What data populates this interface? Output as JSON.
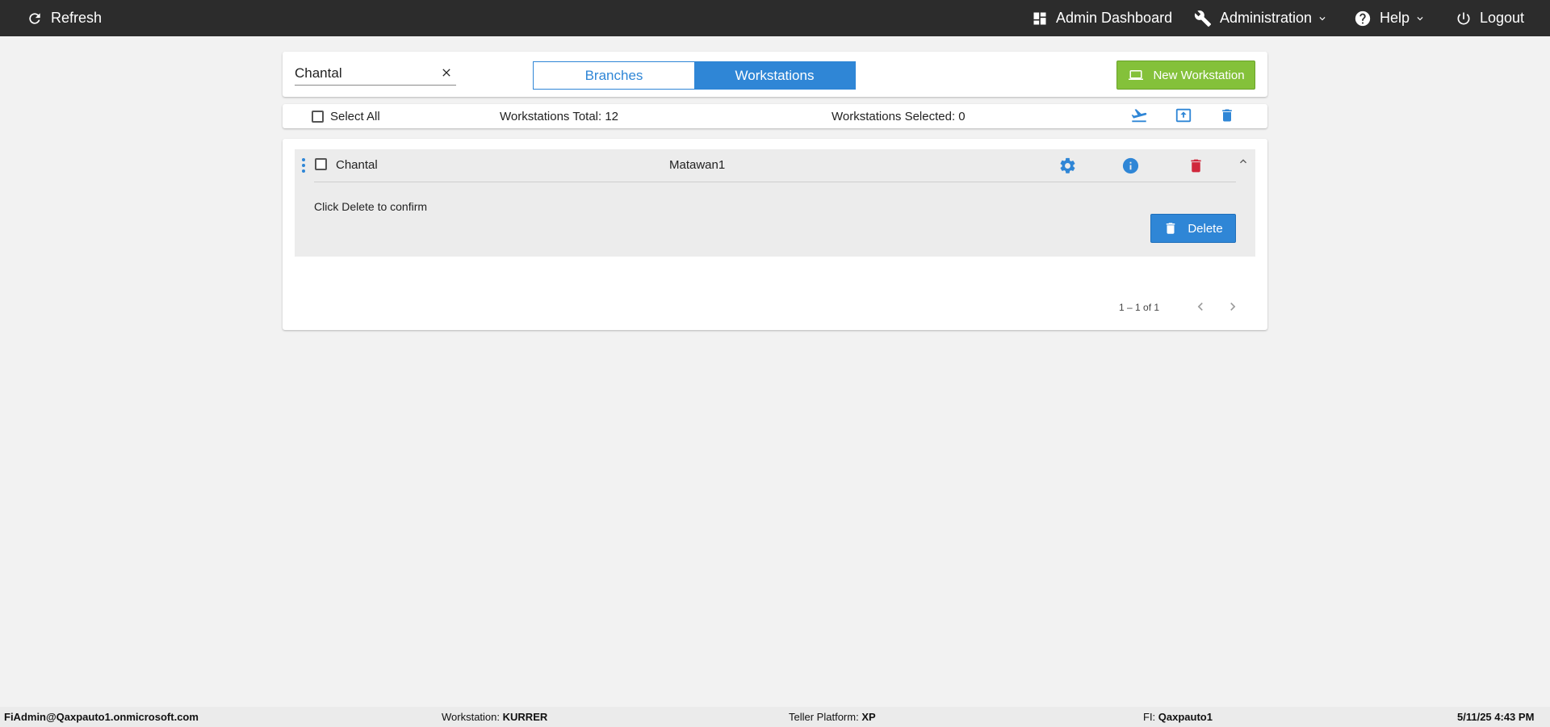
{
  "topbar": {
    "refresh_label": "Refresh",
    "admin_dashboard_label": "Admin Dashboard",
    "administration_label": "Administration",
    "help_label": "Help",
    "logout_label": "Logout"
  },
  "search": {
    "value": "Chantal",
    "clear_icon": "close-icon"
  },
  "tabs": {
    "branches_label": "Branches",
    "workstations_label": "Workstations",
    "active": "Workstations"
  },
  "new_workstation_label": "New Workstation",
  "toolbar": {
    "select_all_label": "Select All",
    "total_label": "Workstations Total: 12",
    "selected_label": "Workstations Selected: 0",
    "icons": [
      "plane-departure-icon",
      "upload-icon",
      "trash-icon"
    ]
  },
  "list": {
    "rows": [
      {
        "name": "Chantal",
        "branch": "Matawan1",
        "confirm_text": "Click Delete to confirm",
        "delete_label": "Delete"
      }
    ]
  },
  "pagination": {
    "range_label": "1 – 1 of 1"
  },
  "statusbar": {
    "user": "FiAdmin@Qaxpauto1.onmicrosoft.com",
    "workstation_label": "Workstation:",
    "workstation_value": "KURRER",
    "platform_label": "Teller Platform:",
    "platform_value": "XP",
    "fi_label": "FI:",
    "fi_value": "Qaxpauto1",
    "datetime": "5/11/25 4:43 PM"
  },
  "colors": {
    "accent": "#2f86d6",
    "success": "#84c13a",
    "danger": "#d0283c",
    "topbar": "#2c2c2c"
  }
}
